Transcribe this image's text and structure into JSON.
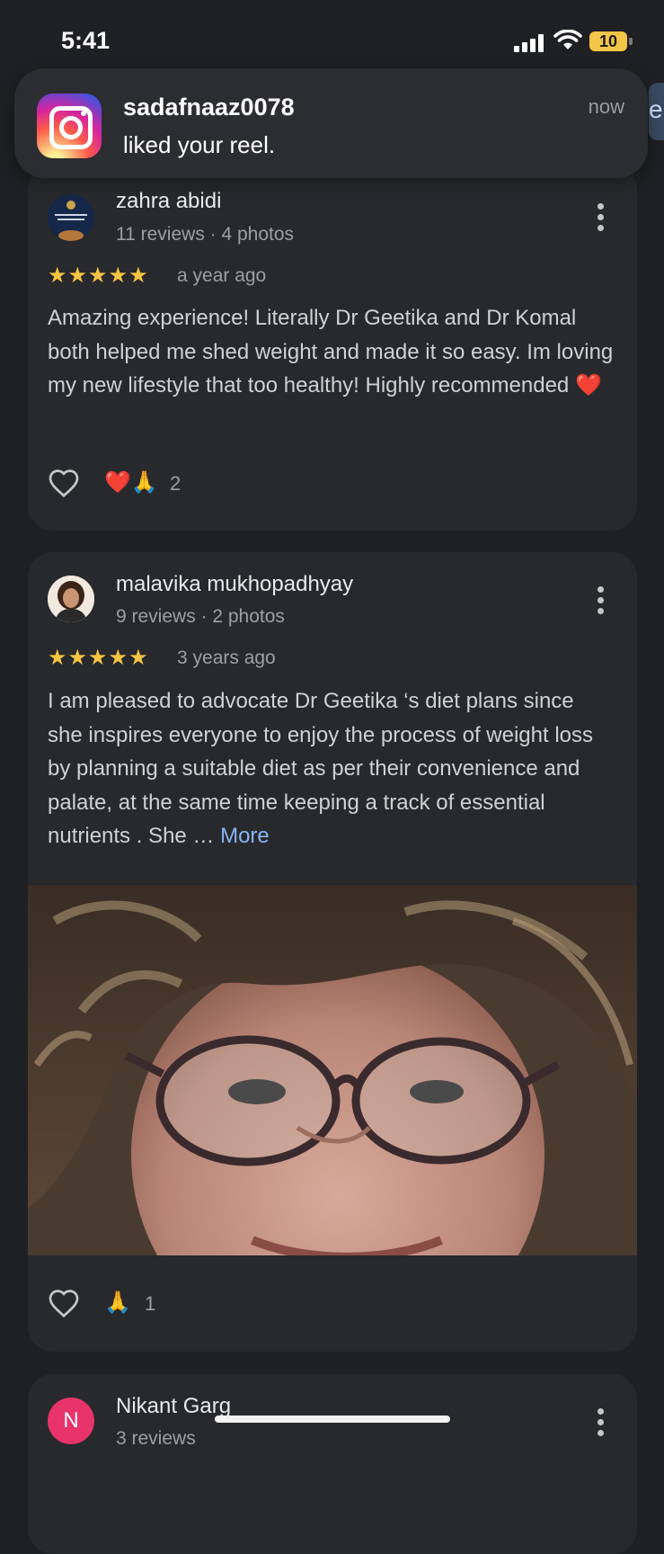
{
  "status_bar": {
    "time": "5:41",
    "battery": "10"
  },
  "notification": {
    "app_icon": "instagram-icon",
    "title": "sadafnaaz0078",
    "body": "liked your reel.",
    "time": "now"
  },
  "peek_chip_text": "er",
  "reviews": [
    {
      "name": "zahra abidi",
      "meta": "11 reviews · 4 photos",
      "rating": 5,
      "stars": "★★★★★",
      "ago": "a year ago",
      "text": "Amazing experience! Literally Dr Geetika and Dr Komal both helped me shed weight and made it so easy. Im loving my new lifestyle that too healthy! Highly recommended ❤️",
      "reactions": "❤️🙏",
      "reaction_count": "2"
    },
    {
      "name": "malavika mukhopadhyay",
      "meta": "9 reviews · 2 photos",
      "rating": 5,
      "stars": "★★★★★",
      "ago": "3 years ago",
      "text": "I am pleased to advocate Dr Geetika ‘s diet plans since she inspires everyone to enjoy the process of weight loss by planning a suitable diet as per their convenience and palate, at the same time keeping a track of essential nutrients . She … ",
      "more_label": "More",
      "reactions": "🙏",
      "reaction_count": "1"
    },
    {
      "name": "Nikant Garg",
      "initial": "N",
      "meta": "3 reviews",
      "avatar_color": "#e8336b"
    }
  ],
  "colors": {
    "background": "#1f2023",
    "card": "#28292c",
    "star": "#f6c543",
    "link": "#8ab4f8"
  }
}
